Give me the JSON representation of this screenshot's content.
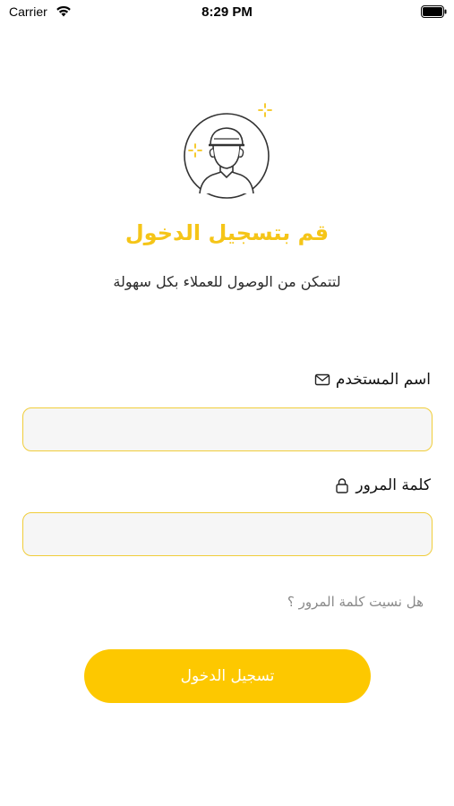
{
  "status_bar": {
    "carrier": "Carrier",
    "time": "8:29 PM"
  },
  "colors": {
    "accent": "#fdc800",
    "title": "#f5c518",
    "input_border": "#f0cd3a",
    "input_bg": "#f6f6f6",
    "muted_text": "#8a8a8a"
  },
  "header": {
    "avatar_icon": "person-avatar-icon",
    "title": "قم بتسجيل الدخول",
    "subtitle": "لتتمكن من الوصول للعملاء بكل سهولة"
  },
  "form": {
    "username": {
      "label": "اسم المستخدم",
      "icon": "envelope-icon",
      "value": ""
    },
    "password": {
      "label": "كلمة المرور",
      "icon": "lock-icon",
      "value": ""
    },
    "forgot_password": "هل نسيت كلمة المرور ؟",
    "submit_label": "تسجيل الدخول"
  }
}
